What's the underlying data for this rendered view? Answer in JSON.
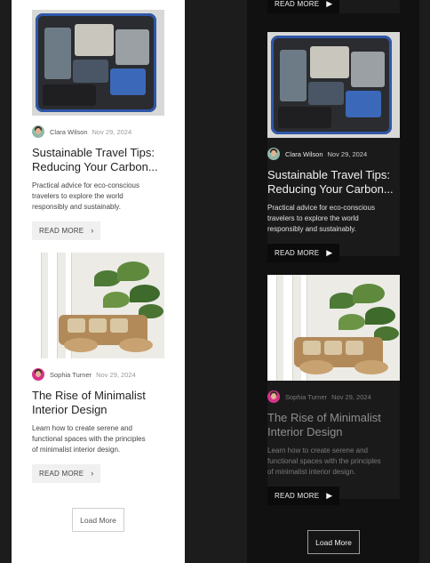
{
  "posts": [
    {
      "author": "Clara Wilson",
      "date": "Nov 29, 2024",
      "title_line1": "Sustainable Travel Tips:",
      "title_line2": "Reducing Your Carbon...",
      "excerpt_line1": "Practical advice for eco-conscious",
      "excerpt_line2": "travelers to explore the world",
      "excerpt_line3": "responsibly and sustainably.",
      "read_more": "READ MORE",
      "image": "packed-suitcase-photo",
      "avatar_color": "#8fb8a8"
    },
    {
      "author": "Sophia Turner",
      "date": "Nov 29, 2024",
      "title_line1": "The Rise of Minimalist",
      "title_line2": "Interior Design",
      "excerpt_line1": "Learn how to create serene and",
      "excerpt_line2": "functional spaces with the principles",
      "excerpt_line3": "of minimalist interior design.",
      "read_more": "READ MORE",
      "image": "patio-furniture-photo",
      "avatar_color": "#d6338a"
    }
  ],
  "load_more_label": "Load More",
  "icons": {
    "read_more_light": "chevron-right-icon",
    "read_more_dark": "caret-right-icon"
  },
  "colors": {
    "page_bg": "#1c1c1c",
    "light_panel": "#ffffff",
    "dark_panel": "#111111"
  }
}
